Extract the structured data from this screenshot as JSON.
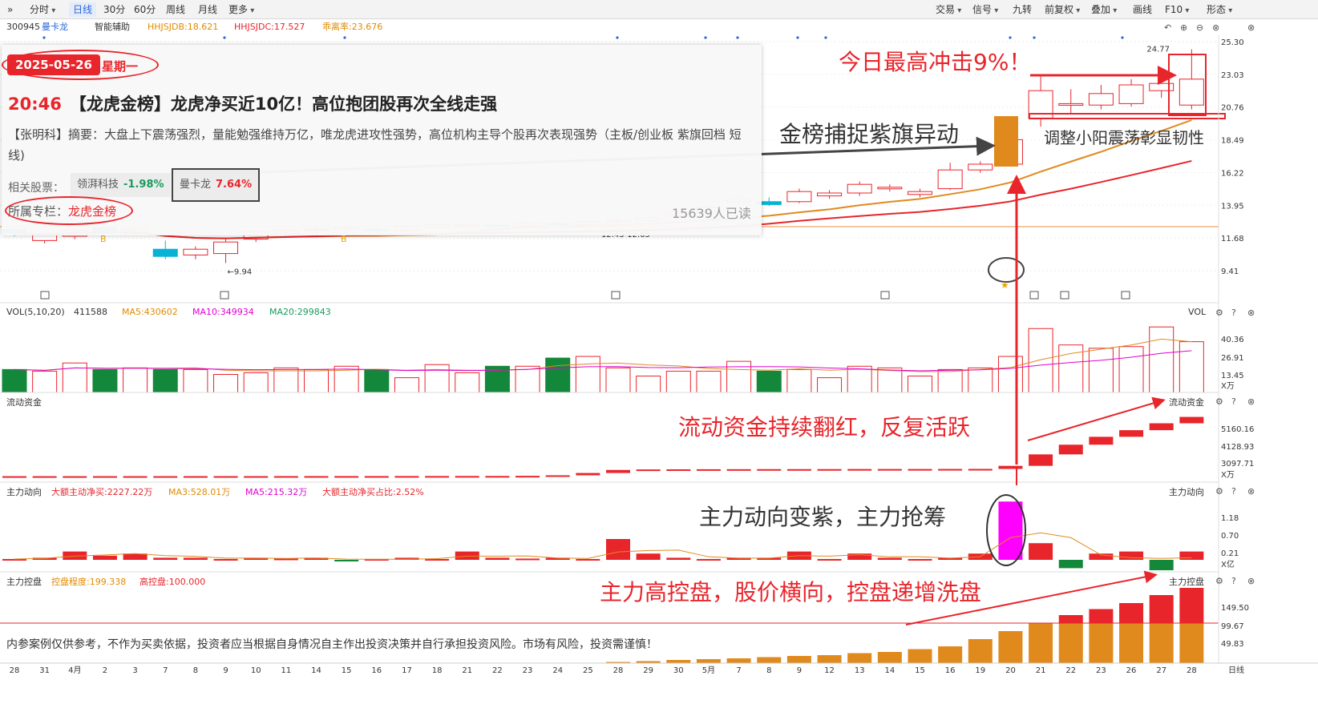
{
  "toolbar": {
    "collapse_icon": "double-chevron-right-icon",
    "periods": [
      "分时",
      "日线",
      "30分",
      "60分",
      "周线",
      "月线",
      "更多"
    ],
    "active": "日线",
    "right": [
      "交易",
      "信号",
      "九转",
      "前复权",
      "叠加",
      "画线",
      "F10",
      "形态"
    ],
    "icons": [
      "gear-icon",
      "help-icon",
      "close-icon"
    ]
  },
  "header": {
    "code": "300945",
    "name": "曼卡龙",
    "smart": "智能辅助",
    "ind1": "HHJSJDB:18.621",
    "ind2": "HHJSJDC:17.527",
    "ind3": "乖离率:23.676"
  },
  "price_axis": [
    "25.30",
    "23.03",
    "20.76",
    "18.49",
    "16.22",
    "13.95",
    "11.68",
    "9.41"
  ],
  "price_marks": {
    "high": "24.77",
    "low": "9.94",
    "range": "12.43-12.65"
  },
  "news": {
    "date": "2025-05-26",
    "weekday": "星期一",
    "time": "20:46",
    "title": "【龙虎金榜】龙虎净买近10亿！高位抱团股再次全线走强",
    "summary": "【张明科】摘要：大盘上下震荡强烈，量能勉强维持万亿，唯龙虎进攻性强势，高位机构主导个股再次表现强势（主板/创业板 紫旗回档 短线)",
    "related_label": "相关股票：",
    "stock1": "领湃科技",
    "stock1_chg": "-1.98%",
    "stock2": "曼卡龙",
    "stock2_chg": "7.64%",
    "column_label": "所属专栏：",
    "column": "龙虎金榜",
    "reads": "15639人已读"
  },
  "annotations": {
    "a1": "今日最高冲击9%！",
    "a2": "金榜捕捉紫旗异动",
    "a3": "调整小阳震荡彰显韧性",
    "a4": "流动资金持续翻红，反复活跃",
    "a5": "主力动向变紫，主力抢筹",
    "a6": "主力高控盘，股价横向，控盘递增洗盘"
  },
  "vol": {
    "title": "VOL(5,10,20)",
    "v": "411588",
    "ma5": "MA5:430602",
    "ma10": "MA10:349934",
    "ma20": "MA20:299843",
    "name": "VOL",
    "axis": [
      "40.36",
      "26.91",
      "13.45"
    ],
    "unit": "X万"
  },
  "flow": {
    "title": "流动资金",
    "axis": [
      "5160.16",
      "4128.93",
      "3097.71"
    ],
    "unit": "X万"
  },
  "main": {
    "title": "主力动向",
    "net": "大额主动净买:2227.22万",
    "ma3": "MA3:528.01万",
    "ma5": "MA5:215.32万",
    "ratio": "大额主动净买占比:2.52%",
    "axis": [
      "1.18",
      "0.70",
      "0.21"
    ],
    "unit": "X亿"
  },
  "ctrl": {
    "title": "主力控盘",
    "degree": "控盘程度:199.338",
    "high": "高控盘:100.000",
    "axis": [
      "149.50",
      "99.67",
      "49.83"
    ]
  },
  "disclaimer": "内参案例仅供参考，不作为买卖依据，投资者应当根据自身情况自主作出投资决策并自行承担投资风险。市场有风险，投资需谨慎！",
  "dates": [
    "28",
    "31",
    "4月",
    "2",
    "3",
    "7",
    "8",
    "9",
    "10",
    "11",
    "14",
    "15",
    "16",
    "17",
    "18",
    "21",
    "22",
    "23",
    "24",
    "25",
    "28",
    "29",
    "30",
    "5月",
    "7",
    "8",
    "9",
    "12",
    "13",
    "14",
    "15",
    "16",
    "19",
    "20",
    "21",
    "22",
    "23",
    "26",
    "27",
    "28"
  ],
  "period_label": "日线",
  "chart_data": {
    "type": "candlestick",
    "price_ylim": [
      9.41,
      25.3
    ],
    "candles": [
      {
        "o": 12.3,
        "c": 12.0,
        "h": 12.5,
        "l": 11.8
      },
      {
        "o": 11.5,
        "c": 11.9,
        "h": 12.1,
        "l": 11.3
      },
      {
        "o": 11.8,
        "c": 12.2,
        "h": 12.3,
        "l": 11.6
      },
      {
        "o": 12.4,
        "c": 12.1,
        "h": 12.6,
        "l": 11.9
      },
      {
        "o": 12.0,
        "c": 12.3,
        "h": 12.5,
        "l": 11.9
      },
      {
        "o": 10.9,
        "c": 10.4,
        "h": 11.5,
        "l": 10.2
      },
      {
        "o": 10.5,
        "c": 10.9,
        "h": 11.1,
        "l": 10.2
      },
      {
        "o": 10.6,
        "c": 11.4,
        "h": 11.6,
        "l": 9.94
      },
      {
        "o": 11.6,
        "c": 12.1,
        "h": 12.2,
        "l": 11.4
      },
      {
        "o": 12.0,
        "c": 12.2,
        "h": 12.4,
        "l": 11.9
      },
      {
        "o": 12.2,
        "c": 12.3,
        "h": 12.5,
        "l": 12.0
      },
      {
        "o": 12.3,
        "c": 12.4,
        "h": 12.5,
        "l": 12.1
      },
      {
        "o": 12.3,
        "c": 12.2,
        "h": 12.5,
        "l": 12.0
      },
      {
        "o": 12.2,
        "c": 12.5,
        "h": 12.6,
        "l": 12.1
      },
      {
        "o": 12.4,
        "c": 12.6,
        "h": 12.7,
        "l": 12.3
      },
      {
        "o": 12.5,
        "c": 12.6,
        "h": 12.8,
        "l": 12.4
      },
      {
        "o": 12.6,
        "c": 12.5,
        "h": 12.8,
        "l": 12.3
      },
      {
        "o": 12.5,
        "c": 12.7,
        "h": 12.9,
        "l": 12.4
      },
      {
        "o": 12.7,
        "c": 12.6,
        "h": 12.9,
        "l": 12.5
      },
      {
        "o": 12.6,
        "c": 12.8,
        "h": 13.0,
        "l": 12.5
      },
      {
        "o": 12.8,
        "c": 12.9,
        "h": 13.1,
        "l": 12.6
      },
      {
        "o": 12.9,
        "c": 13.1,
        "h": 13.3,
        "l": 12.8
      },
      {
        "o": 13.2,
        "c": 13.4,
        "h": 13.6,
        "l": 13.0
      },
      {
        "o": 13.5,
        "c": 13.8,
        "h": 14.0,
        "l": 13.3
      },
      {
        "o": 14.2,
        "c": 14.4,
        "h": 14.6,
        "l": 14.0
      },
      {
        "o": 14.2,
        "c": 14.0,
        "h": 14.5,
        "l": 13.9
      },
      {
        "o": 14.2,
        "c": 14.9,
        "h": 15.1,
        "l": 14.1
      },
      {
        "o": 14.6,
        "c": 14.8,
        "h": 15.0,
        "l": 14.4
      },
      {
        "o": 14.8,
        "c": 15.4,
        "h": 15.6,
        "l": 14.6
      },
      {
        "o": 15.1,
        "c": 15.2,
        "h": 15.4,
        "l": 14.9
      },
      {
        "o": 14.7,
        "c": 14.9,
        "h": 15.1,
        "l": 14.5
      },
      {
        "o": 15.1,
        "c": 16.4,
        "h": 16.9,
        "l": 15.0
      },
      {
        "o": 16.4,
        "c": 16.8,
        "h": 17.0,
        "l": 16.2
      },
      {
        "o": 16.8,
        "c": 18.5,
        "h": 18.5,
        "l": 16.8
      },
      {
        "o": 20.0,
        "c": 21.9,
        "h": 23.0,
        "l": 19.4
      },
      {
        "o": 21.0,
        "c": 21.0,
        "h": 22.0,
        "l": 20.3
      },
      {
        "o": 20.9,
        "c": 21.7,
        "h": 22.3,
        "l": 20.6
      },
      {
        "o": 21.0,
        "c": 22.3,
        "h": 22.7,
        "l": 20.8
      },
      {
        "o": 21.9,
        "c": 22.4,
        "h": 23.0,
        "l": 21.4
      },
      {
        "o": 20.9,
        "c": 22.7,
        "h": 24.77,
        "l": 20.6
      }
    ],
    "vol_ylim": [
      0,
      45
    ],
    "volumes": [
      14,
      13,
      18,
      14,
      15,
      14,
      14,
      11,
      12,
      15,
      14,
      16,
      14,
      9,
      17,
      12,
      16,
      16,
      21,
      22,
      15,
      10,
      13,
      13,
      19,
      13,
      14,
      9,
      16,
      15,
      10,
      14,
      15,
      22,
      39,
      29,
      27,
      28,
      40,
      31
    ],
    "flow_values": [
      3095,
      3095,
      3095,
      3096,
      3096,
      3096,
      3097,
      3097,
      3097,
      3098,
      3098,
      3099,
      3099,
      3100,
      3101,
      3102,
      3103,
      3108,
      3130,
      3220,
      3340,
      3360,
      3365,
      3368,
      3370,
      3372,
      3372,
      3373,
      3375,
      3376,
      3376,
      3378,
      3380,
      3500,
      3950,
      4330,
      4640,
      4900,
      5170,
      5420
    ],
    "main_values": [
      0.02,
      0.05,
      0.2,
      0.1,
      0.15,
      0.05,
      0.05,
      0.02,
      0.05,
      0.03,
      0.05,
      -0.03,
      0.02,
      0.05,
      0.02,
      0.2,
      0.05,
      0.03,
      0.05,
      0.02,
      0.5,
      0.15,
      0.05,
      0.02,
      0.05,
      0.05,
      0.2,
      0.02,
      0.15,
      0.05,
      0.02,
      0.05,
      0.15,
      1.4,
      0.4,
      -0.2,
      0.15,
      0.2,
      -0.25,
      0.2
    ],
    "ctrl_values": [
      0,
      0,
      0,
      0,
      0,
      0,
      0,
      0,
      0,
      0,
      0,
      0,
      0,
      0,
      0,
      0,
      0,
      0,
      0,
      0,
      3,
      5,
      8,
      10,
      12,
      15,
      18,
      20,
      25,
      28,
      35,
      42,
      60,
      80,
      100,
      120,
      135,
      150,
      170,
      188
    ]
  }
}
